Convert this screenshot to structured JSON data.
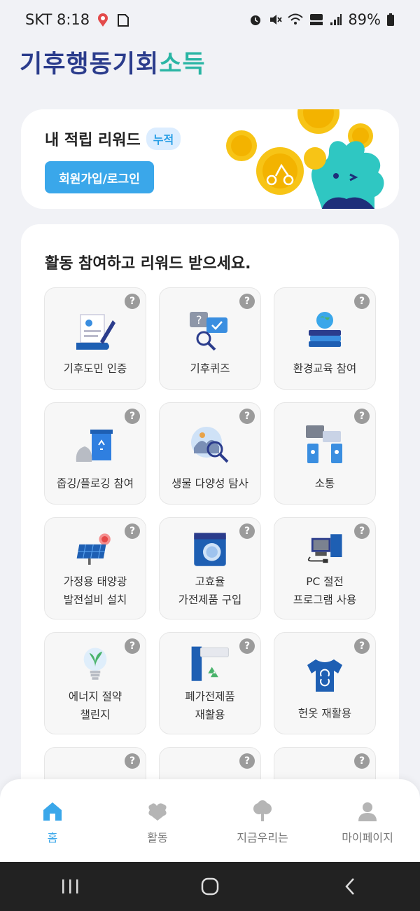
{
  "status_bar": {
    "carrier_time": "SKT 8:18",
    "battery": "89%"
  },
  "logo": {
    "part1": "기후행동기회",
    "part2": "소득"
  },
  "reward": {
    "title": "내 적립 리워드",
    "badge": "누적",
    "login_button": "회원가입/로그인"
  },
  "activities": {
    "title": "활동 참여하고 리워드 받으세요.",
    "help_symbol": "?",
    "items": [
      {
        "label": "기후도민 인증",
        "icon": "certificate-icon"
      },
      {
        "label": "기후퀴즈",
        "icon": "quiz-icon"
      },
      {
        "label": "환경교육 참여",
        "icon": "education-icon"
      },
      {
        "label": "줍깅/플로깅 참여",
        "icon": "trash-bin-icon"
      },
      {
        "label": "생물 다양성 탐사",
        "icon": "biodiversity-icon"
      },
      {
        "label": "소통",
        "icon": "chat-icon"
      },
      {
        "label": "가정용 태양광\n발전설비 설치",
        "icon": "solar-panel-icon"
      },
      {
        "label": "고효율\n가전제품 구입",
        "icon": "washing-machine-icon"
      },
      {
        "label": "PC 절전\n프로그램 사용",
        "icon": "pc-icon"
      },
      {
        "label": "에너지 절약\n챌린지",
        "icon": "lightbulb-icon"
      },
      {
        "label": "폐가전제품\n재활용",
        "icon": "appliance-recycle-icon"
      },
      {
        "label": "헌옷 재활용",
        "icon": "tshirt-icon"
      }
    ]
  },
  "bottom_nav": {
    "items": [
      {
        "label": "홈",
        "icon": "home-icon",
        "active": true
      },
      {
        "label": "활동",
        "icon": "activity-icon",
        "active": false
      },
      {
        "label": "지금우리는",
        "icon": "tree-icon",
        "active": false
      },
      {
        "label": "마이페이지",
        "icon": "person-icon",
        "active": false
      }
    ]
  },
  "colors": {
    "accent": "#3aa7ea",
    "logo_navy": "#2b3c8c",
    "logo_green": "#2ab5a4",
    "background": "#f1f2f6"
  }
}
